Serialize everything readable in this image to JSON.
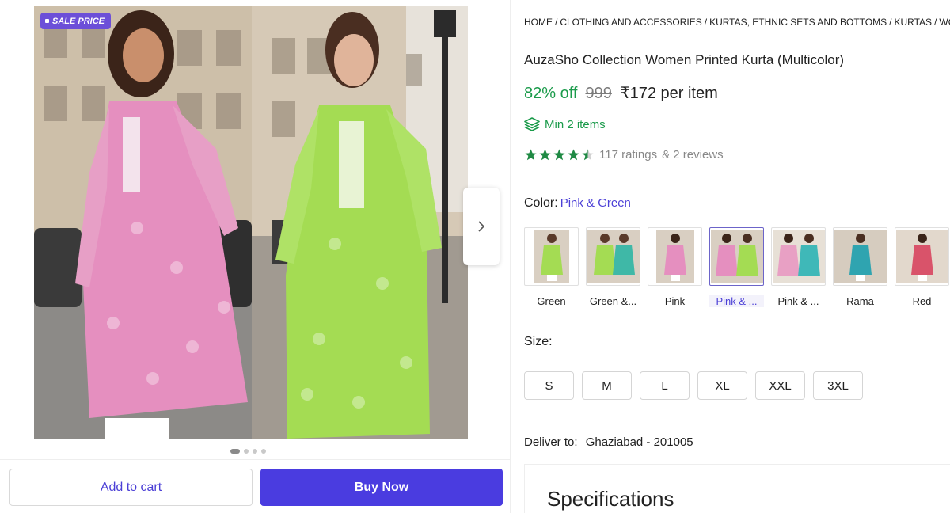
{
  "gallery": {
    "badge": "SALE PRICE",
    "actions": {
      "add_to_cart": "Add to cart",
      "buy_now": "Buy Now"
    }
  },
  "breadcrumb": [
    "HOME",
    "CLOTHING AND ACCESSORIES",
    "KURTAS, ETHNIC SETS AND BOTTOMS",
    "KURTAS",
    "WOMEN"
  ],
  "product": {
    "title": "AuzaSho Collection Women Printed Kurta (Multicolor)",
    "discount": "82% off",
    "mrp": "999",
    "price": "₹172 per item",
    "min_items": "Min 2 items",
    "rating_stars": 4.5,
    "ratings": "117 ratings",
    "reviews": "& 2 reviews"
  },
  "color": {
    "label": "Color:",
    "selected": "Pink & Green",
    "options": [
      {
        "name": "Green"
      },
      {
        "name": "Green &..."
      },
      {
        "name": "Pink"
      },
      {
        "name": "Pink & ..."
      },
      {
        "name": "Pink & ..."
      },
      {
        "name": "Rama"
      },
      {
        "name": "Red"
      }
    ]
  },
  "size": {
    "label": "Size:",
    "options": [
      "S",
      "M",
      "L",
      "XL",
      "XXL",
      "3XL"
    ]
  },
  "delivery": {
    "label": "Deliver to:",
    "location": "Ghaziabad - 201005"
  },
  "specifications": {
    "title": "Specifications"
  },
  "colors": {
    "accent": "#4a3ce0",
    "discount_green": "#1b9b4b",
    "badge": "#6c4fd8",
    "pink_kurta": "#e58fbf",
    "green_kurta": "#a4dc53"
  }
}
